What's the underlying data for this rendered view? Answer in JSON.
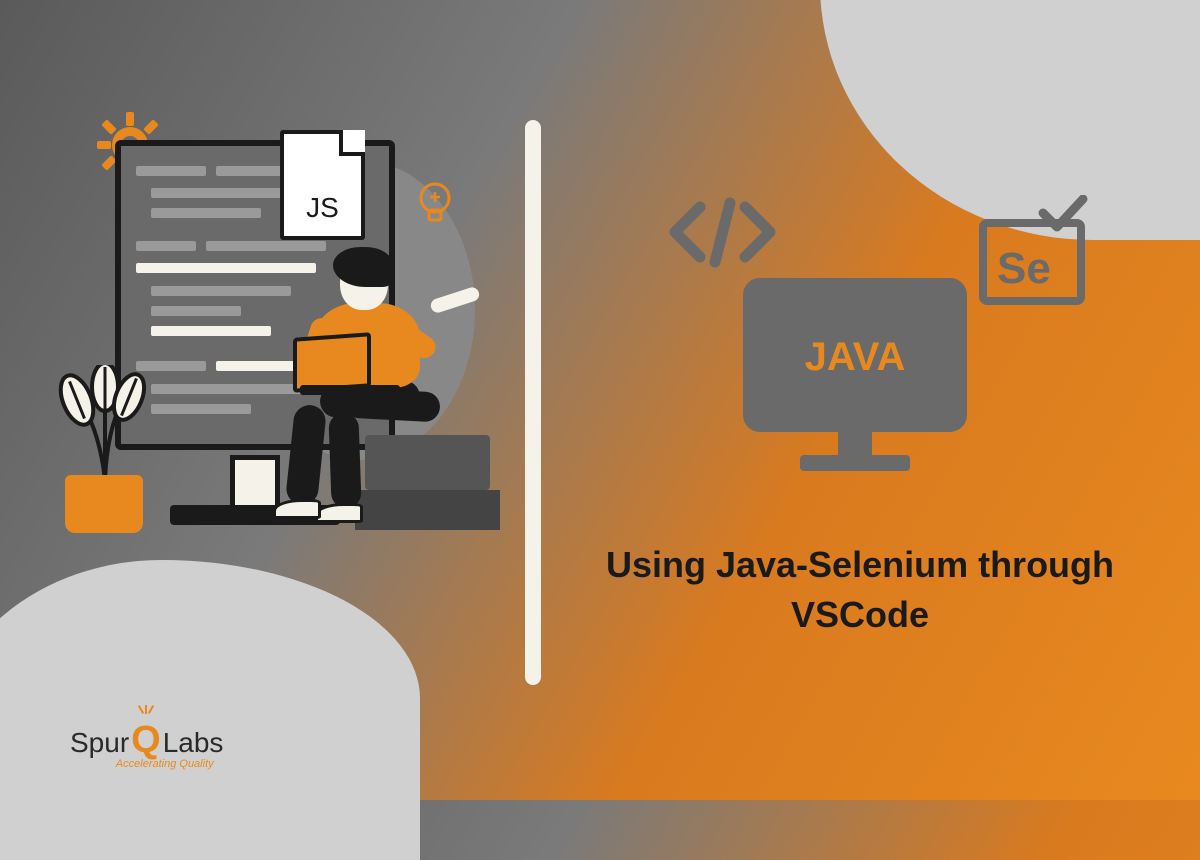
{
  "title": "Using Java-Selenium through VSCode",
  "jsDocLabel": "JS",
  "javaMonitorLabel": "JAVA",
  "seleniumLabel": "Se",
  "logo": {
    "brand_prefix": "Spur",
    "brand_accent": "Q",
    "brand_suffix": "Labs",
    "tagline": "Accelerating Quality"
  },
  "colors": {
    "accent": "#e8891f",
    "dark": "#1a1a1a",
    "gray": "#6a6a6a",
    "lightGray": "#d0d0d0"
  }
}
